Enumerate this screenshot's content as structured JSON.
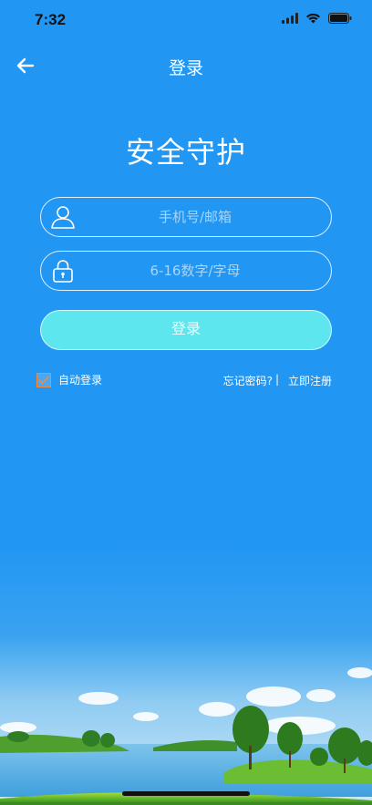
{
  "status_bar": {
    "time": "7:32"
  },
  "nav": {
    "title": "登录"
  },
  "login": {
    "heading": "安全守护",
    "account_placeholder": "手机号/邮箱",
    "password_placeholder": "6-16数字/字母",
    "login_button": "登录",
    "auto_login": "自动登录",
    "auto_login_checked": true,
    "forgot_password": "忘记密码?",
    "separator": "|",
    "register": "立即注册"
  },
  "colors": {
    "primary": "#2196f3",
    "button": "#5ee6ef",
    "checkbox_border": "#f08a3e"
  },
  "icons": [
    "back-arrow-icon",
    "user-icon",
    "lock-icon",
    "check-icon",
    "wifi-icon",
    "battery-icon",
    "signal-icon"
  ]
}
